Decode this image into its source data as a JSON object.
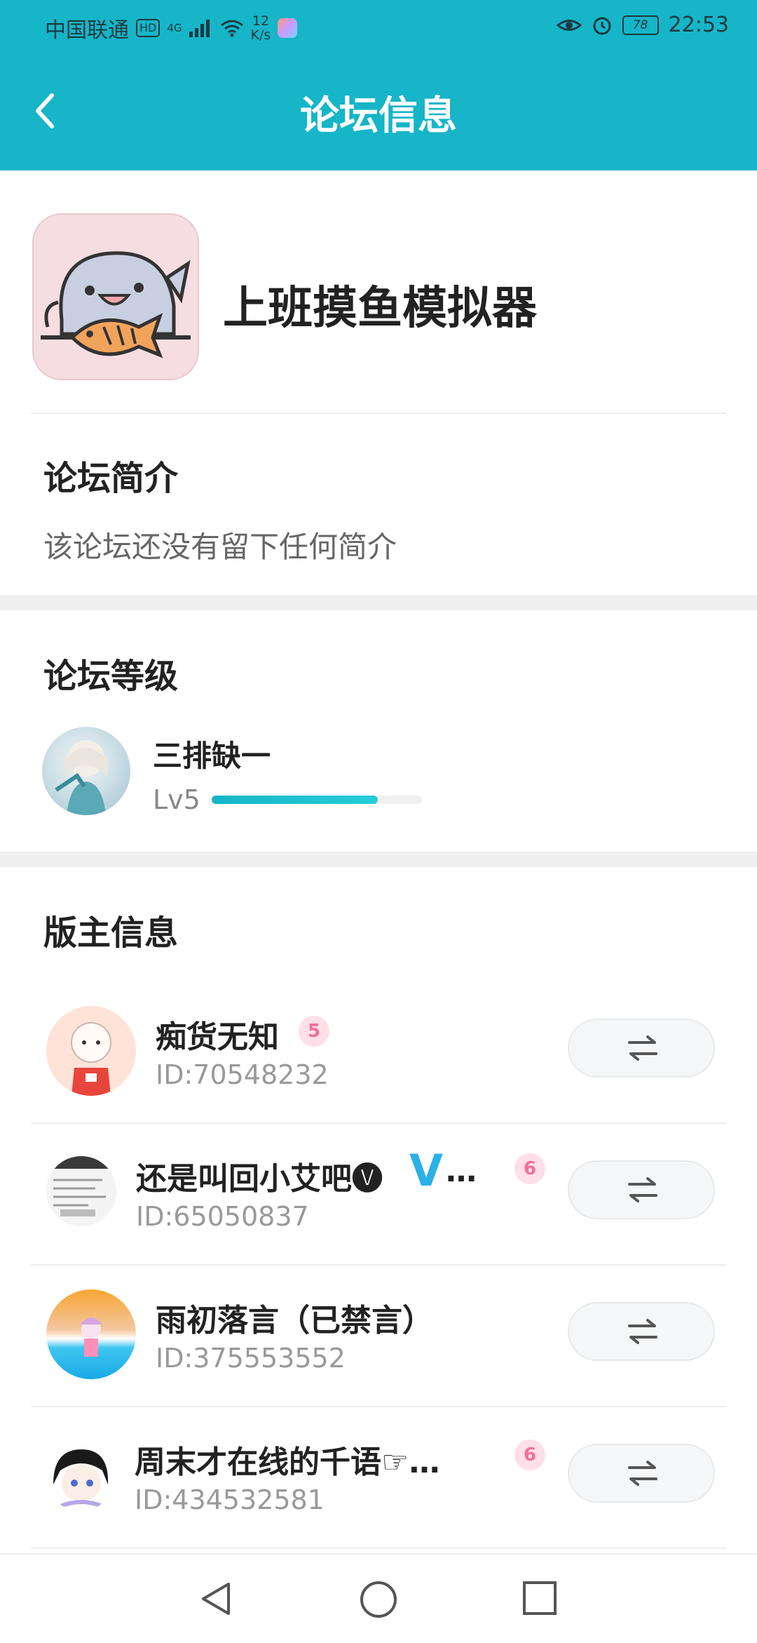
{
  "status_bar": {
    "carrier": "中国联通",
    "hd_badge": "HD",
    "network": "4G",
    "speed_value": "12",
    "speed_unit": "K/s",
    "battery": "78",
    "time": "22:53"
  },
  "header": {
    "title": "论坛信息"
  },
  "forum": {
    "name": "上班摸鱼模拟器",
    "intro_title": "论坛简介",
    "intro_text": "该论坛还没有留下任何简介"
  },
  "level_section": {
    "title": "论坛等级",
    "user_name": "三排缺一",
    "level_label": "Lv5",
    "progress_fraction": 0.79
  },
  "moderator_section": {
    "title": "版主信息",
    "moderators": [
      {
        "name": "痴货无知",
        "id": "ID:70548232",
        "level_badge": "5",
        "avatar_icon": "bald-kid-avatar"
      },
      {
        "name": "还是叫回小艾吧🅥",
        "verified": "V",
        "ellipsis": "…",
        "id": "ID:65050837",
        "level_badge": "6",
        "avatar_icon": "document-avatar"
      },
      {
        "name": "雨初落言（已禁言）",
        "id": "ID:375553552",
        "avatar_icon": "sunset-avatar"
      },
      {
        "name": "周末才在线的千语☞…",
        "id": "ID:434532581",
        "level_badge": "6",
        "avatar_icon": "anime-avatar"
      }
    ]
  },
  "colors": {
    "accent": "#16b5c8",
    "badge_pink": "#f0709a",
    "verified_blue": "#2ab0e8"
  }
}
